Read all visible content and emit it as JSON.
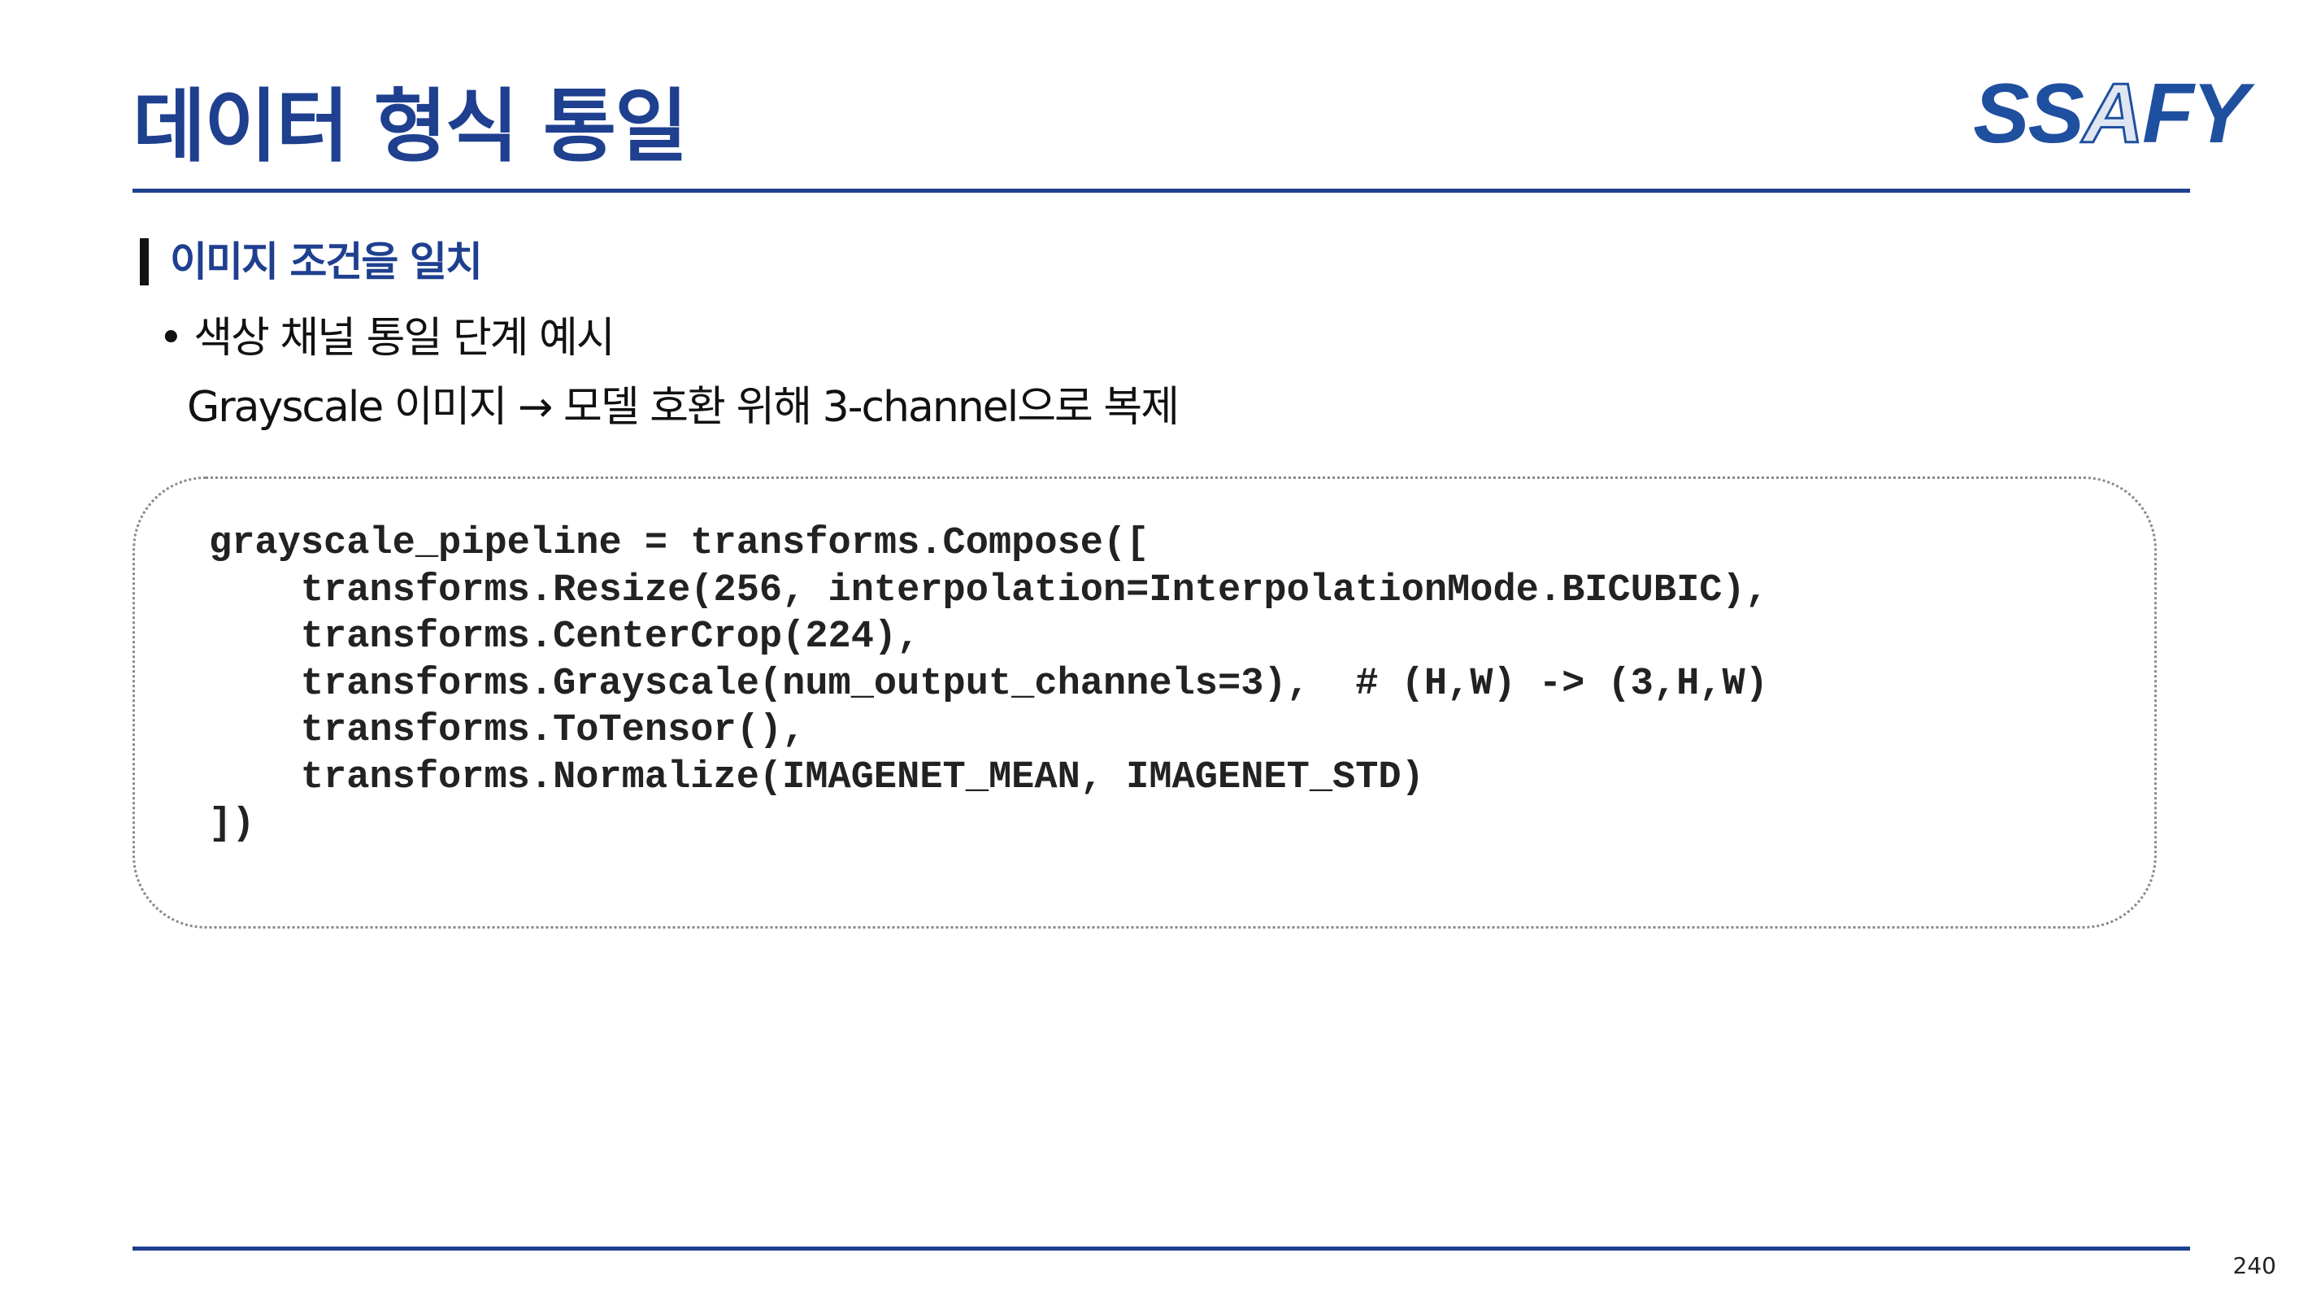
{
  "slide": {
    "title": "데이터 형식 통일",
    "logo_text": [
      "SS",
      "A",
      "FY"
    ],
    "section_heading": "이미지 조건을 일치",
    "bullet": "• 색상 채널 통일 단계 예시",
    "subline": "Grayscale 이미지 → 모델 호환 위해 3-channel으로 복제",
    "page_number": "240"
  },
  "code_block": {
    "lines": [
      "grayscale_pipeline = transforms.Compose([",
      "    transforms.Resize(256, interpolation=InterpolationMode.BICUBIC),",
      "    transforms.CenterCrop(224),",
      "    transforms.Grayscale(num_output_channels=3),  # (H,W) -> (3,H,W)",
      "    transforms.ToTensor(),",
      "    transforms.Normalize(IMAGENET_MEAN, IMAGENET_STD)",
      "])"
    ]
  },
  "colors": {
    "title": "#1f3f8f",
    "rule": "#1f3f8f",
    "logo": "#1f4f9f",
    "code_border": "#8a8a8a"
  }
}
